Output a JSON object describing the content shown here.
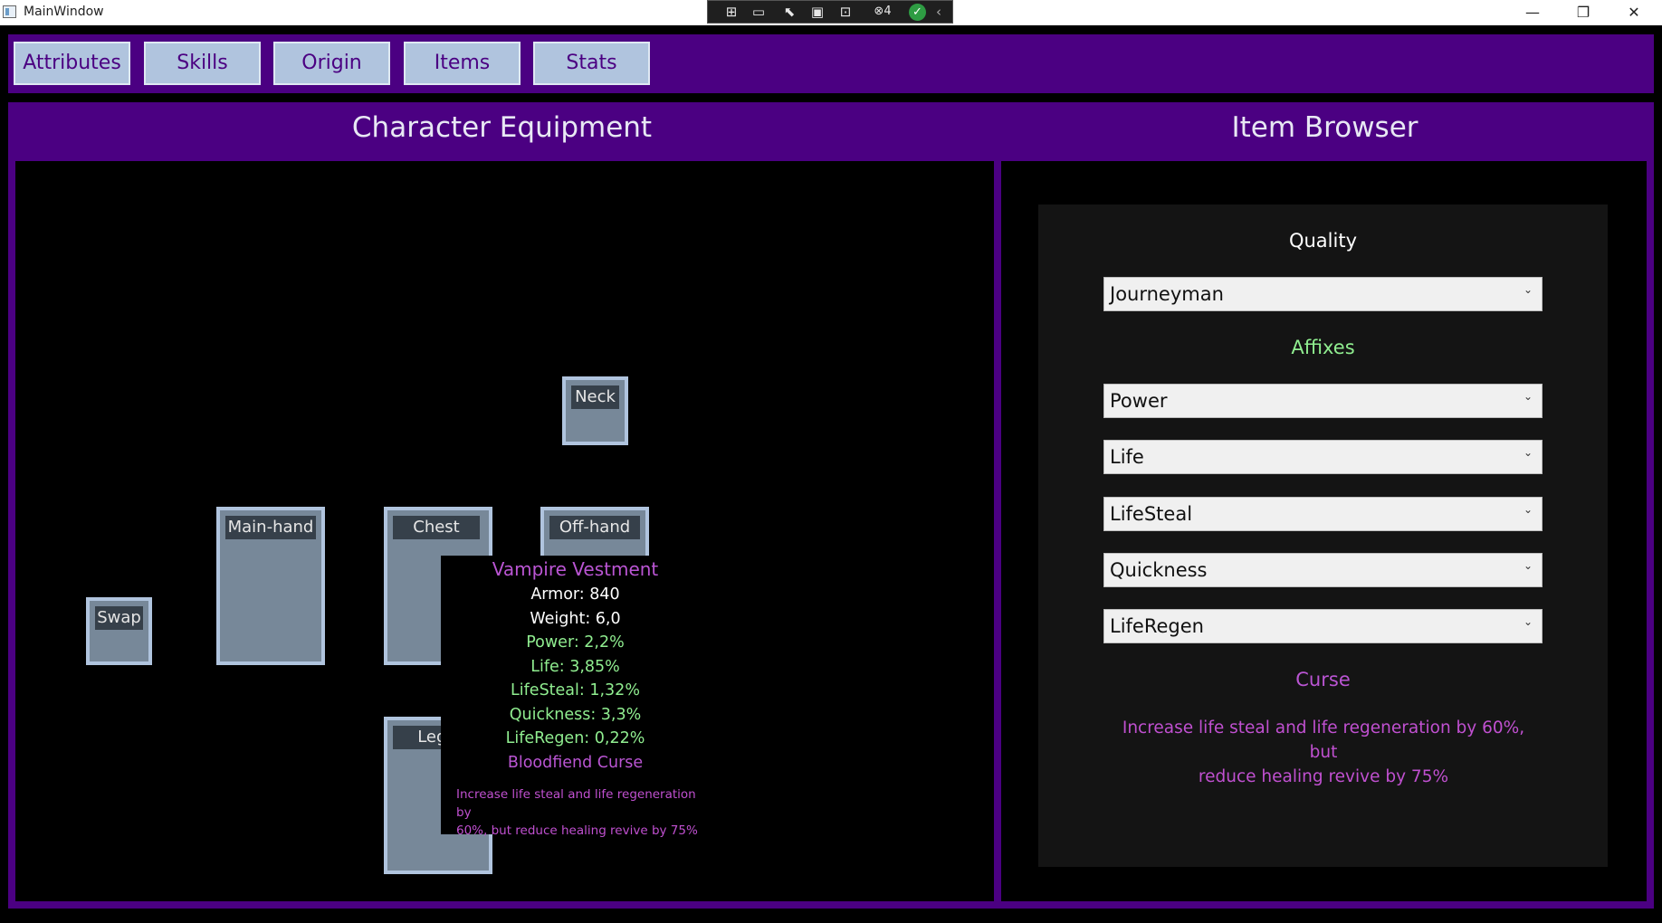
{
  "window": {
    "title": "MainWindow",
    "controls": {
      "minimize": "—",
      "restore": "❐",
      "close": "✕"
    }
  },
  "devtools": {
    "icons": [
      "live-visual-tree-icon",
      "record-icon",
      "select-element-icon",
      "display-layout-icon",
      "track-focus-icon",
      "binding-failures-icon",
      "hot-reload-icon"
    ],
    "binding_failures_count": "4",
    "hot_reload_status": "✓"
  },
  "tabs": [
    {
      "label": "Attributes"
    },
    {
      "label": "Skills"
    },
    {
      "label": "Origin"
    },
    {
      "label": "Items"
    },
    {
      "label": "Stats"
    }
  ],
  "headers": {
    "equipment": "Character Equipment",
    "browser": "Item Browser"
  },
  "slots": {
    "neck": "Neck",
    "mainhand": "Main-hand",
    "chest": "Chest",
    "offhand": "Off-hand",
    "swap": "Swap",
    "legs": "Legs"
  },
  "tooltip": {
    "name": "Vampire Vestment",
    "armor": "Armor: 840",
    "weight": "Weight: 6,0",
    "affixes": [
      "Power: 2,2%",
      "Life: 3,85%",
      "LifeSteal: 1,32%",
      "Quickness: 3,3%",
      "LifeRegen: 0,22%"
    ],
    "curse_name": "Bloodfiend Curse",
    "curse_desc_line1": "Increase life steal and life regeneration by",
    "curse_desc_line2": "60%, but reduce healing revive by 75%"
  },
  "browser": {
    "quality_label": "Quality",
    "quality_value": "Journeyman",
    "affixes_label": "Affixes",
    "affix_values": [
      "Power",
      "Life",
      "LifeSteal",
      "Quickness",
      "LifeRegen"
    ],
    "curse_label": "Curse",
    "curse_desc_line1": "Increase life steal and life regeneration by 60%, but",
    "curse_desc_line2": "reduce healing revive by 75%"
  },
  "colors": {
    "accent_purple": "#4b0082",
    "slot_fill": "#778899",
    "slot_border": "#b0c4de",
    "tab_fill": "#b0c4de",
    "affix_green": "#90ee90",
    "curse_orchid": "#ba55d3"
  }
}
